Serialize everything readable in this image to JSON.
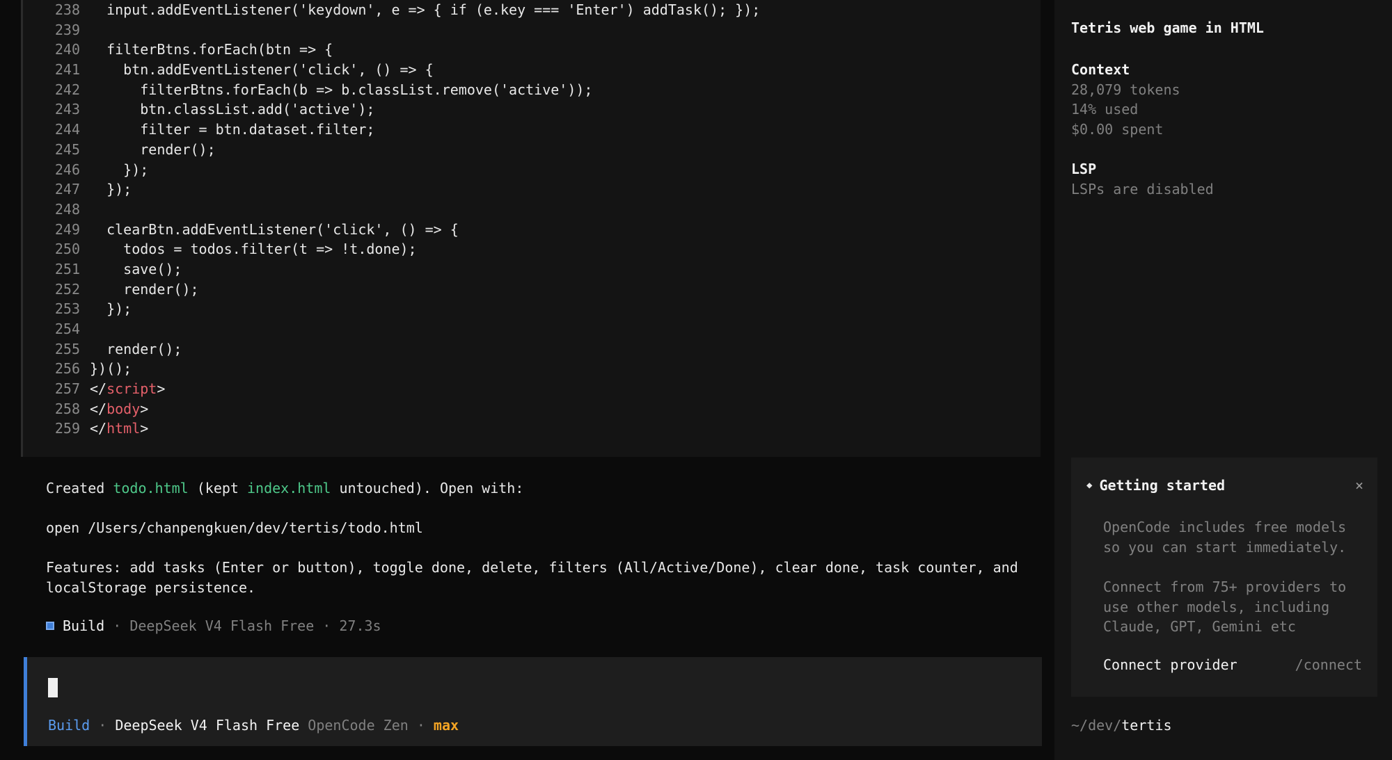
{
  "code_lines": [
    {
      "num": "238",
      "text": "  input.addEventListener('keydown', e => { if (e.key === 'Enter') addTask(); });"
    },
    {
      "num": "239",
      "text": ""
    },
    {
      "num": "240",
      "text": "  filterBtns.forEach(btn => {"
    },
    {
      "num": "241",
      "text": "    btn.addEventListener('click', () => {"
    },
    {
      "num": "242",
      "text": "      filterBtns.forEach(b => b.classList.remove('active'));"
    },
    {
      "num": "243",
      "text": "      btn.classList.add('active');"
    },
    {
      "num": "244",
      "text": "      filter = btn.dataset.filter;"
    },
    {
      "num": "245",
      "text": "      render();"
    },
    {
      "num": "246",
      "text": "    });"
    },
    {
      "num": "247",
      "text": "  });"
    },
    {
      "num": "248",
      "text": ""
    },
    {
      "num": "249",
      "text": "  clearBtn.addEventListener('click', () => {"
    },
    {
      "num": "250",
      "text": "    todos = todos.filter(t => !t.done);"
    },
    {
      "num": "251",
      "text": "    save();"
    },
    {
      "num": "252",
      "text": "    render();"
    },
    {
      "num": "253",
      "text": "  });"
    },
    {
      "num": "254",
      "text": ""
    },
    {
      "num": "255",
      "text": "  render();"
    },
    {
      "num": "256",
      "text": "})();"
    }
  ],
  "closing_tags": [
    {
      "num": "257",
      "open": "</",
      "tag": "script",
      "close": ">"
    },
    {
      "num": "258",
      "open": "</",
      "tag": "body",
      "close": ">"
    },
    {
      "num": "259",
      "open": "</",
      "tag": "html",
      "close": ">"
    }
  ],
  "message": {
    "created_prefix": "Created ",
    "created_file": "todo.html",
    "kept_prefix": " (kept ",
    "kept_file": "index.html",
    "kept_suffix": " untouched). Open with:",
    "command": "open /Users/chanpengkuen/dev/tertis/todo.html",
    "features": "Features: add tasks (Enter or button), toggle done, delete, filters (All/Active/Done), clear done, task counter, and\nlocalStorage persistence."
  },
  "build_status": {
    "mode": "Build",
    "sep1": " · ",
    "model": "DeepSeek V4 Flash Free",
    "sep2": " · ",
    "duration": "27.3s"
  },
  "prompt": {
    "mode": "Build",
    "sep1": " · ",
    "model": "DeepSeek V4 Flash Free",
    "provider": " OpenCode Zen",
    "sep2": " · ",
    "variant": "max"
  },
  "sidebar": {
    "title": "Tetris web game in HTML",
    "context_heading": "Context",
    "tokens": "28,079 tokens",
    "used": "14% used",
    "spent": "$0.00 spent",
    "lsp_heading": "LSP",
    "lsp_status": "LSPs are disabled",
    "getting_started": {
      "title": "Getting started",
      "close": "×",
      "text1": "OpenCode includes free models\nso you can start immediately.",
      "text2": "Connect from 75+ providers to\nuse other models, including\nClaude, GPT, Gemini etc",
      "connect_label": "Connect provider",
      "connect_cmd": "/connect"
    },
    "path_prefix": "~/dev/",
    "path_dir": "tertis"
  },
  "colors": {
    "accent_blue": "#3f7fd8",
    "file_green": "#4ec98a",
    "tag_red": "#e5606a",
    "variant_orange": "#f5a524"
  }
}
